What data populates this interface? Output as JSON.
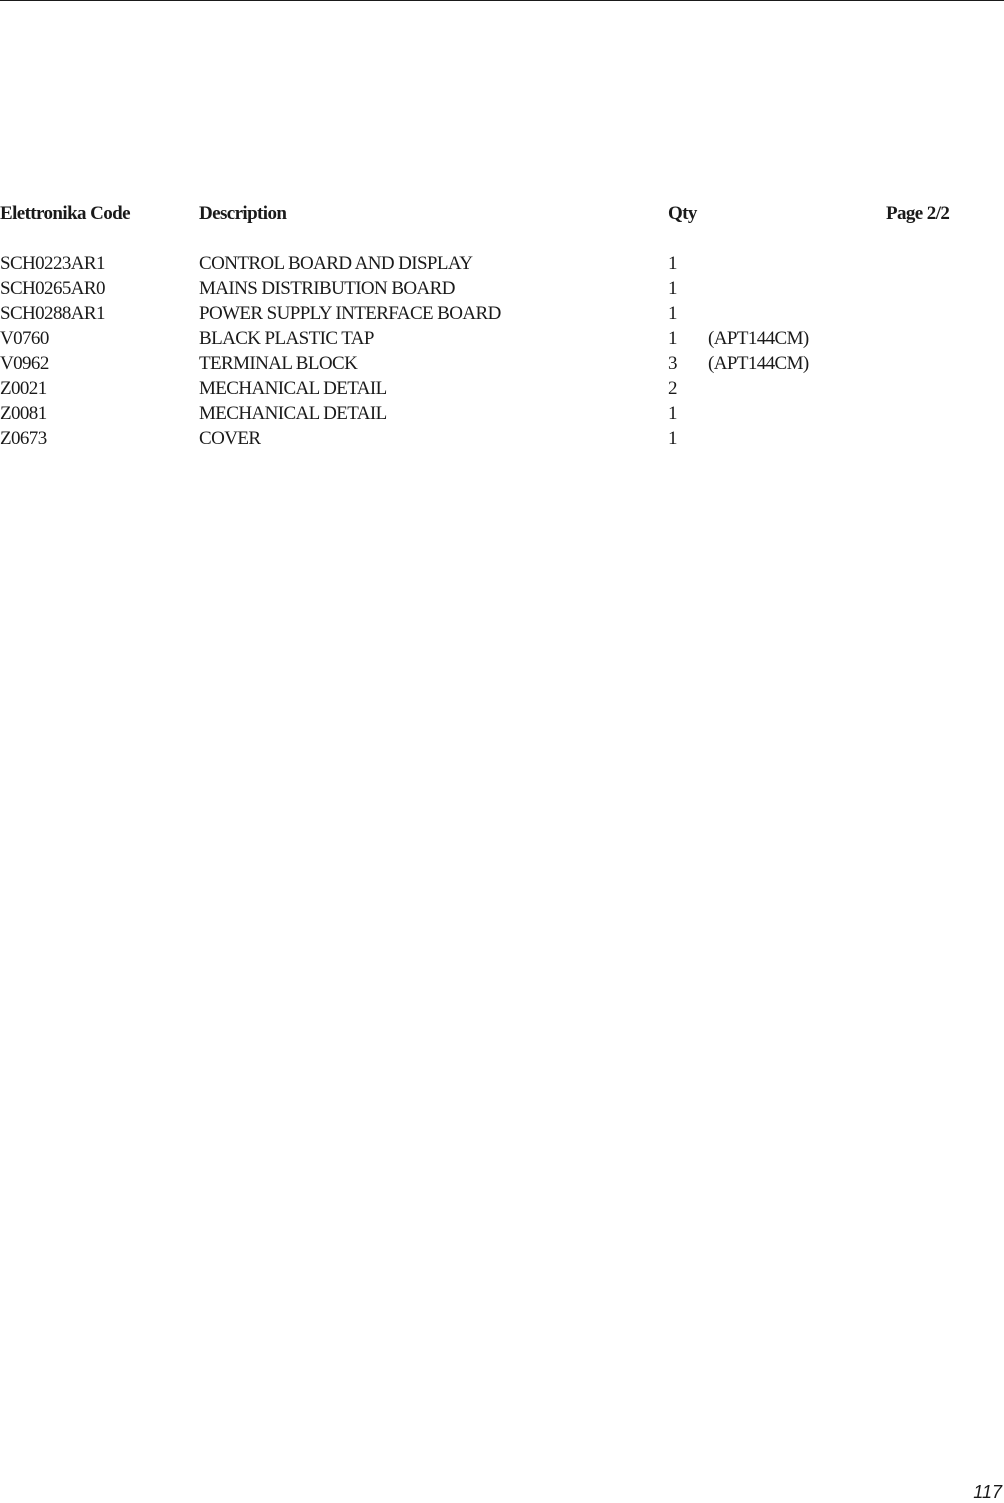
{
  "header": {
    "code_label": "Elettronika Code",
    "description_label": "Description",
    "qty_label": "Qty",
    "page_label": "Page 2/2"
  },
  "rows": [
    {
      "code": "SCH0223AR1",
      "description": "CONTROL BOARD AND DISPLAY",
      "qty": "1",
      "note": ""
    },
    {
      "code": "SCH0265AR0",
      "description": "MAINS DISTRIBUTION BOARD",
      "qty": "1",
      "note": ""
    },
    {
      "code": "SCH0288AR1",
      "description": "POWER SUPPLY INTERFACE BOARD",
      "qty": "1",
      "note": ""
    },
    {
      "code": "V0760",
      "description": "BLACK PLASTIC TAP",
      "qty": "1",
      "note": "(APT144CM)"
    },
    {
      "code": "V0962",
      "description": "TERMINAL BLOCK",
      "qty": "3",
      "note": "(APT144CM)"
    },
    {
      "code": "Z0021",
      "description": "MECHANICAL DETAIL",
      "qty": "2",
      "note": ""
    },
    {
      "code": "Z0081",
      "description": "MECHANICAL DETAIL",
      "qty": "1",
      "note": ""
    },
    {
      "code": "Z0673",
      "description": "COVER",
      "qty": "1",
      "note": ""
    }
  ],
  "footer": {
    "page_number": "117"
  }
}
